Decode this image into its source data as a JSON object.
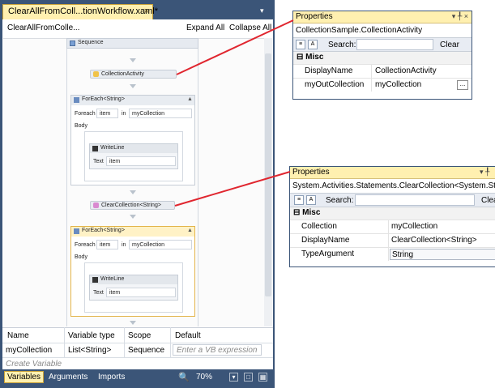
{
  "designer": {
    "tab_title": "ClearAllFromColl...tionWorkflow.xaml*",
    "tab_close": "×",
    "breadcrumb": "ClearAllFromColle...",
    "expand_all": "Expand All",
    "collapse_all": "Collapse All",
    "sequence_label": "Sequence",
    "collection_activity": "CollectionActivity",
    "clear_collection": "ClearCollection<String>",
    "foreach1": {
      "title": "ForEach<String>",
      "foreach_label": "Foreach",
      "item": "item",
      "in_label": "in",
      "collection": "myCollection",
      "body_label": "Body",
      "writeline_title": "WriteLine",
      "text_label": "Text",
      "text_value": "item"
    },
    "foreach2": {
      "title": "ForEach<String>",
      "foreach_label": "Foreach",
      "item": "item",
      "in_label": "in",
      "collection": "myCollection",
      "body_label": "Body",
      "writeline_title": "WriteLine",
      "text_label": "Text",
      "text_value": "item"
    },
    "variables_grid": {
      "headers": [
        "Name",
        "Variable type",
        "Scope",
        "Default"
      ],
      "row": [
        "myCollection",
        "List<String>",
        "Sequence",
        "Enter a VB expression"
      ],
      "create_variable": "Create Variable"
    },
    "bottom_tabs": [
      "Variables",
      "Arguments",
      "Imports"
    ],
    "zoom": "70%"
  },
  "props1": {
    "title": "Properties",
    "title_buttons": "▾ ╀ ×",
    "type_name": "CollectionSample.CollectionActivity",
    "search_label": "Search:",
    "clear_label": "Clear",
    "category": "Misc",
    "rows": [
      {
        "name": "DisplayName",
        "value": "CollectionActivity"
      },
      {
        "name": "myOutCollection",
        "value": "myCollection"
      }
    ],
    "ellipsis": "..."
  },
  "props2": {
    "title": "Properties",
    "title_buttons": "▾ ╀",
    "type_name": "System.Activities.Statements.ClearCollection<System.String>",
    "search_label": "Search:",
    "clear_label": "Clear",
    "category": "Misc",
    "rows": [
      {
        "name": "Collection",
        "value": "myCollection"
      },
      {
        "name": "DisplayName",
        "value": "ClearCollection<String>"
      },
      {
        "name": "TypeArgument",
        "value": "String"
      }
    ]
  },
  "colors": {
    "frame": "#3b5578",
    "tab_selected": "#fff0b0",
    "callout": "#e0262f"
  }
}
